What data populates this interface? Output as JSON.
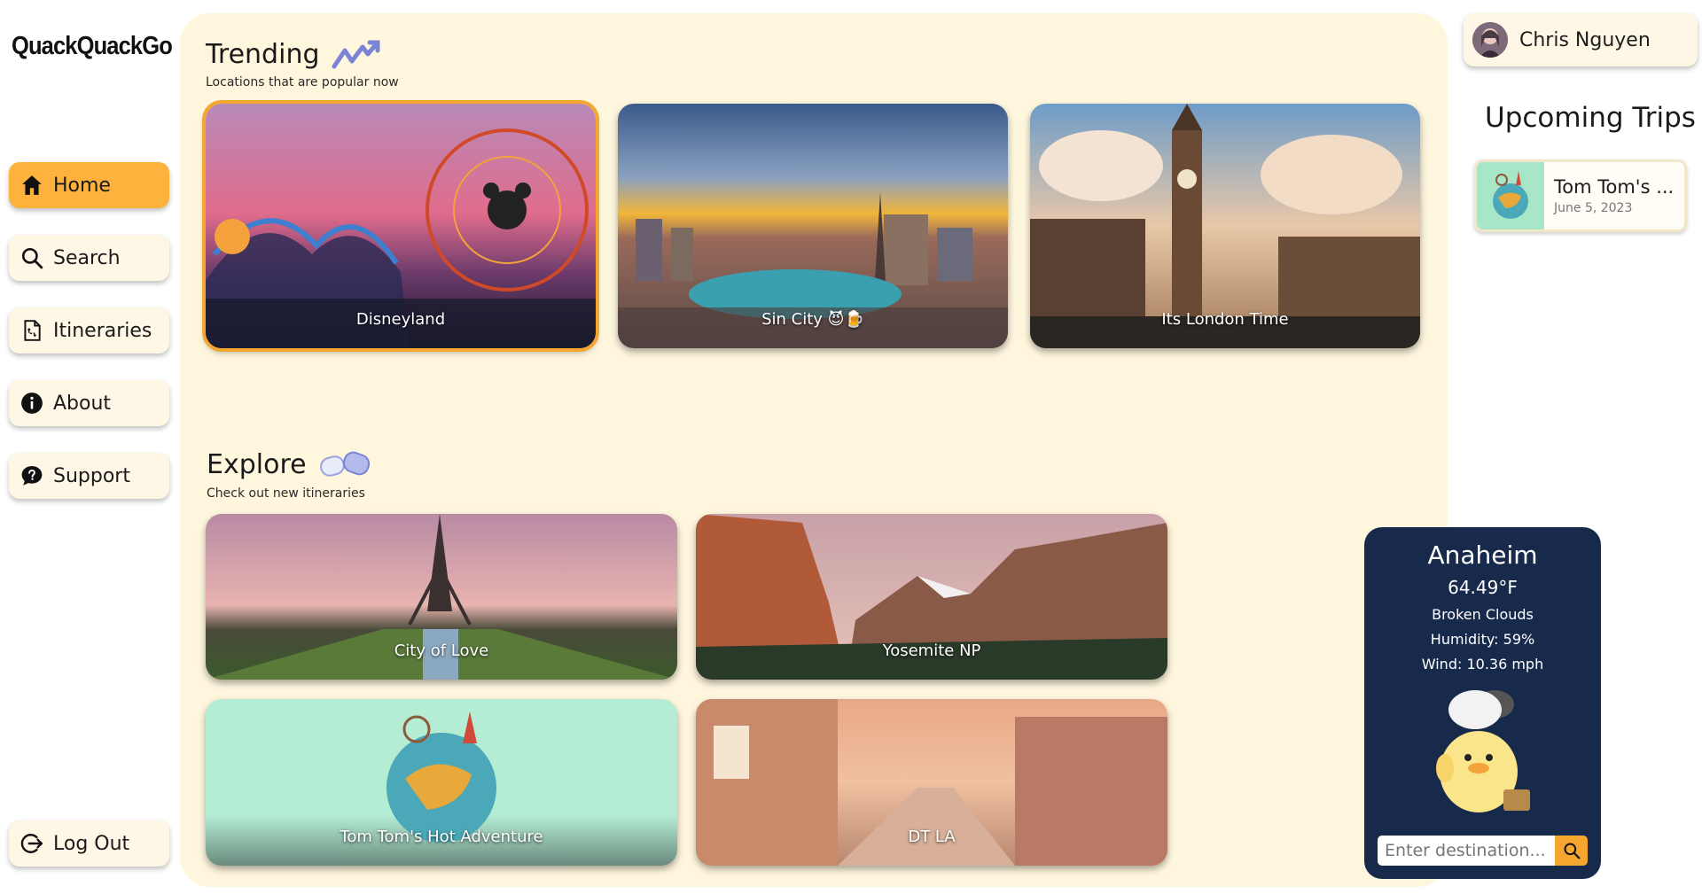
{
  "app": {
    "logo": "QuackQuackGo"
  },
  "nav": {
    "home": "Home",
    "search": "Search",
    "itineraries": "Itineraries",
    "about": "About",
    "support": "Support",
    "logout": "Log Out"
  },
  "trending": {
    "title": "Trending",
    "subtitle": "Locations that are popular now",
    "cards": [
      {
        "label": "Disneyland"
      },
      {
        "label": "Sin City 😈🍺"
      },
      {
        "label": "Its London Time"
      }
    ]
  },
  "explore": {
    "title": "Explore",
    "subtitle": "Check out new itineraries",
    "cards": [
      {
        "label": "City of Love"
      },
      {
        "label": "Yosemite NP"
      },
      {
        "label": "Tom Tom's Hot Adventure"
      },
      {
        "label": "DT LA"
      }
    ]
  },
  "weather": {
    "city": "Anaheim",
    "temperature": "64.49°F",
    "condition": "Broken Clouds",
    "humidity": "Humidity: 59%",
    "wind": "Wind: 10.36 mph",
    "placeholder": "Enter destination..."
  },
  "user": {
    "name": "Chris Nguyen"
  },
  "upcoming": {
    "title": "Upcoming Trips",
    "trips": [
      {
        "name": "Tom Tom's ...",
        "date": "June 5, 2023"
      }
    ]
  },
  "colors": {
    "accent": "#fcb23d",
    "panel": "#fef6dd",
    "weather_bg": "#182a4b"
  }
}
